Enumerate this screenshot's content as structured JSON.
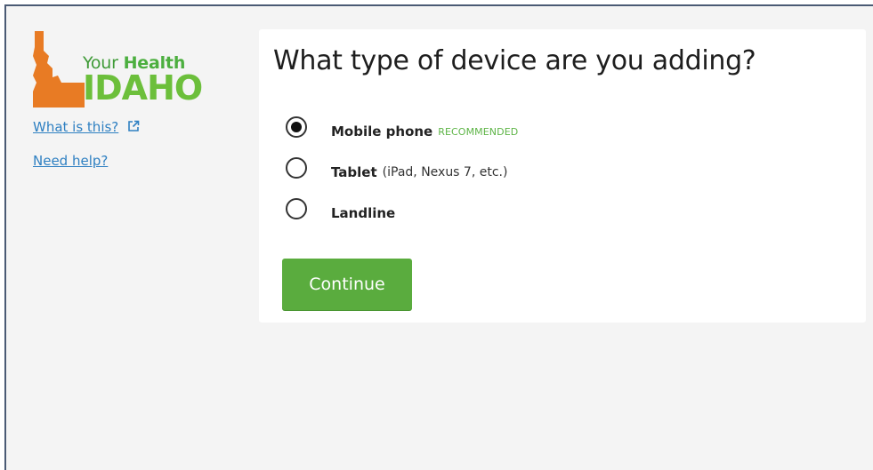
{
  "brand": {
    "logo_line1_plain": "Your",
    "logo_line1_bold": "Health",
    "logo_line2": "IDAHO",
    "colors": {
      "state_shape": "#e87b24",
      "text_green": "#4caf3f",
      "idaho_green": "#6cbf3b"
    }
  },
  "sidebar": {
    "what_is_this": "What is this?",
    "external_icon": "external-link-icon",
    "need_help": "Need help?"
  },
  "card": {
    "title": "What type of device are you adding?",
    "options": [
      {
        "label": "Mobile phone",
        "note": "",
        "badge": "RECOMMENDED",
        "selected": true
      },
      {
        "label": "Tablet",
        "note": "(iPad, Nexus 7, etc.)",
        "badge": "",
        "selected": false
      },
      {
        "label": "Landline",
        "note": "",
        "badge": "",
        "selected": false
      }
    ],
    "continue_label": "Continue"
  },
  "colors": {
    "accent_button": "#5aac3e",
    "link": "#2f80c2",
    "page_background": "#f4f4f4",
    "frame_border": "#4a5a74"
  }
}
